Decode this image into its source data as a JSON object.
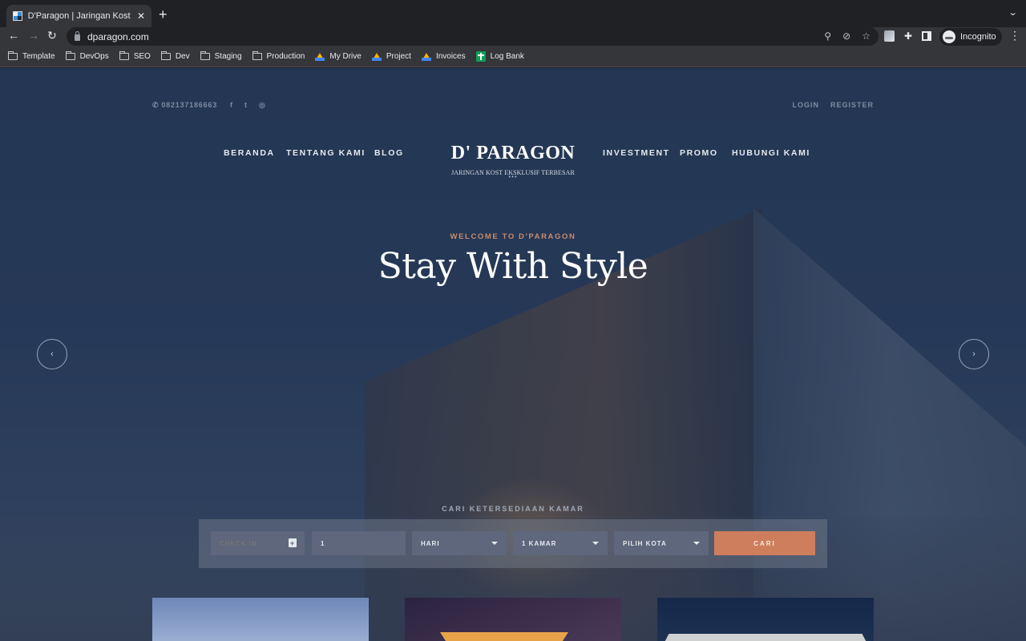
{
  "browser": {
    "tab": {
      "title": "D'Paragon | Jaringan Kost Eksklusif Terbesar",
      "close": "✕"
    },
    "new_tab": "+",
    "tab_menu": "⌄",
    "url": "dparagon.com",
    "nav": {
      "back": "←",
      "forward": "→",
      "reload": "↻"
    },
    "omni_icons": {
      "location": "⚲",
      "tracking": "⊘",
      "bookmark": "☆"
    },
    "profile_label": "Incognito",
    "menu": "⋮",
    "bookmarks": [
      {
        "label": "Template",
        "icon": "folder-icon"
      },
      {
        "label": "DevOps",
        "icon": "folder-icon"
      },
      {
        "label": "SEO",
        "icon": "folder-icon"
      },
      {
        "label": "Dev",
        "icon": "folder-icon"
      },
      {
        "label": "Staging",
        "icon": "folder-icon"
      },
      {
        "label": "Production",
        "icon": "folder-icon"
      },
      {
        "label": "My Drive",
        "icon": "drive-icon"
      },
      {
        "label": "Project",
        "icon": "drive-icon"
      },
      {
        "label": "Invoices",
        "icon": "drive-icon"
      },
      {
        "label": "Log Bank",
        "icon": "sheets-icon"
      }
    ]
  },
  "site": {
    "topbar": {
      "phone": "082137186663",
      "social": {
        "facebook": "f",
        "twitter": "t",
        "instagram": "◎"
      },
      "login": "LOGIN",
      "register": "REGISTER"
    },
    "nav": {
      "left": [
        "BERANDA",
        "TENTANG KAMI",
        "BLOG"
      ],
      "right": [
        "INVESTMENT",
        "PROMO",
        "HUBUNGI KAMI"
      ]
    },
    "logo": {
      "title": "D' PARAGON",
      "subtitle": "JARINGAN KOST EKSKLUSIF TERBESAR",
      "stars": "***"
    },
    "hero": {
      "eyebrow": "WELCOME TO D'PARAGON",
      "headline": "Stay With Style",
      "prev": "‹",
      "next": "›"
    },
    "search": {
      "label": "CARI KETERSEDIAAN KAMAR",
      "check_in_placeholder": "CHECK IN",
      "duration_value": "1",
      "unit_select": "HARI",
      "rooms_select": "1 KAMAR",
      "city_select": "PILIH KOTA",
      "submit": "CARI"
    },
    "colors": {
      "accent": "#cf7e5d",
      "eyebrow": "#c98b6c",
      "field_bg": "#5e677b",
      "hero_overlay": "#29395a"
    }
  }
}
